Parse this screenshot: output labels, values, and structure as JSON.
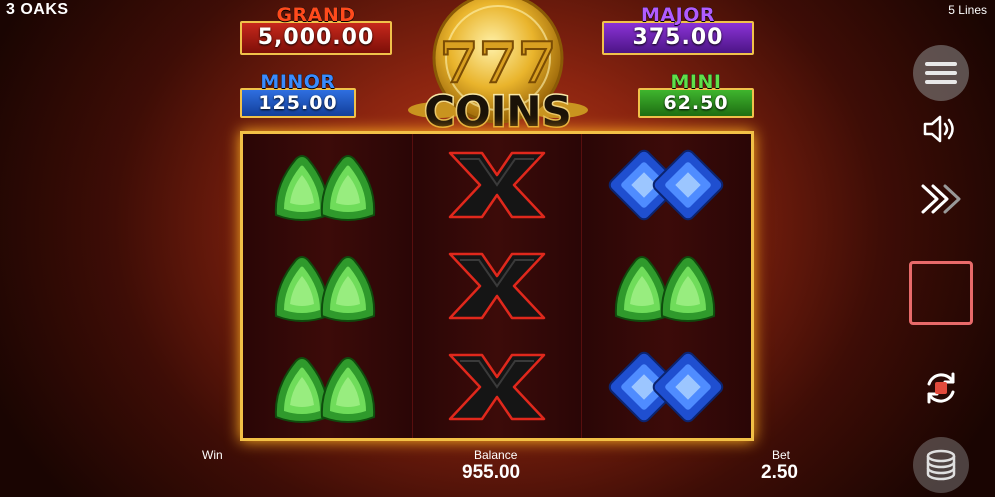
{
  "brand": "3 OAKS",
  "lines_label": "5 Lines",
  "jackpots": {
    "grand": {
      "title": "GRAND",
      "value": "5,000.00"
    },
    "major": {
      "title": "MAJOR",
      "value": "375.00"
    },
    "minor": {
      "title": "MINOR",
      "value": "125.00"
    },
    "mini": {
      "title": "MINI",
      "value": "62.50"
    }
  },
  "logo": {
    "number": "777",
    "word": "COINS"
  },
  "reels": [
    [
      "green-gem",
      "green-gem",
      "green-gem"
    ],
    [
      "x-symbol",
      "x-symbol",
      "x-symbol"
    ],
    [
      "blue-gem",
      "green-gem",
      "blue-gem"
    ]
  ],
  "footer": {
    "win_label": "Win",
    "balance_label": "Balance",
    "balance_value": "955.00",
    "bet_label": "Bet",
    "bet_value": "2.50"
  },
  "icons": {
    "menu": "hamburger-icon",
    "sound": "speaker-icon",
    "turbo": "fast-forward-icon",
    "spin": "square-stop-icon",
    "autoplay": "autoplay-icon",
    "bet_stack": "coin-stack-icon"
  },
  "colors": {
    "frame": "#f2c046",
    "grand": "#ff4a1c",
    "major": "#b15cff",
    "minor": "#3a8bff",
    "mini": "#5fe04a"
  }
}
